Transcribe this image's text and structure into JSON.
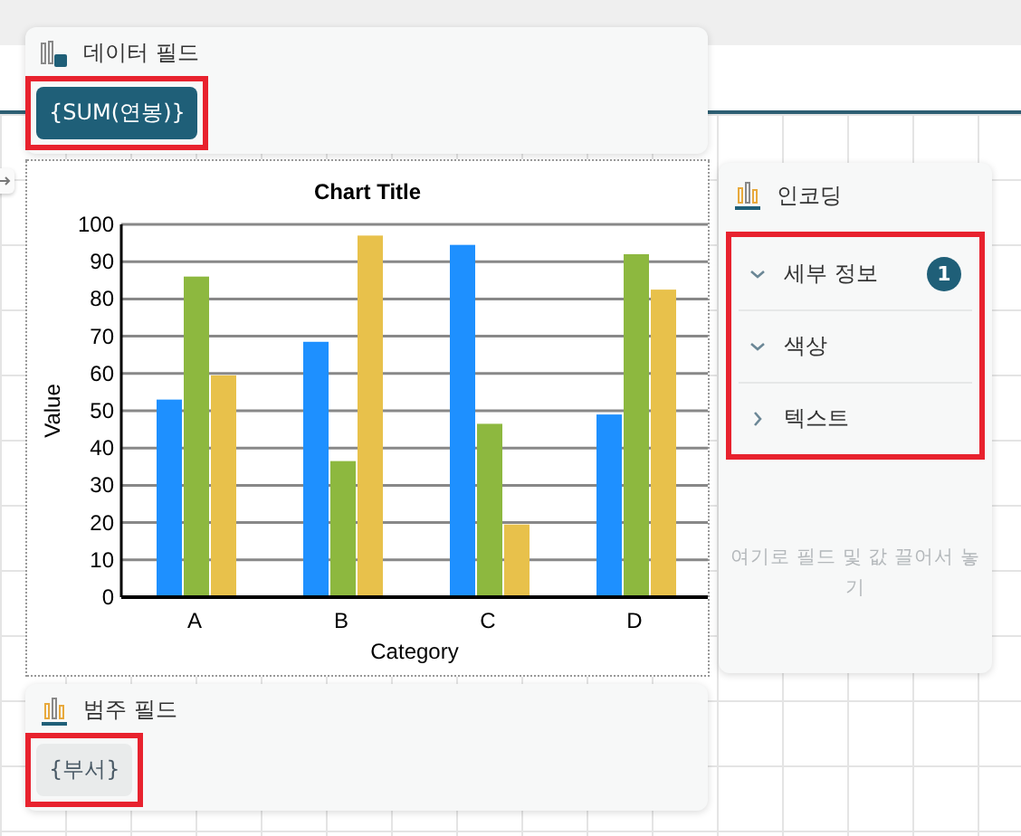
{
  "data_field": {
    "title": "데이터 필드",
    "chips": [
      {
        "label": "{SUM(연봉)}",
        "selected": true,
        "highlighted": true
      }
    ]
  },
  "chart": {
    "chart_data": {
      "type": "bar",
      "title": "Chart Title",
      "xlabel": "Category",
      "ylabel": "Value",
      "categories": [
        "A",
        "B",
        "C",
        "D"
      ],
      "ylim": [
        0,
        100
      ],
      "grid": true,
      "yticks": [
        0,
        10,
        20,
        30,
        40,
        50,
        60,
        70,
        80,
        90,
        100
      ],
      "series": [
        {
          "color": "#1e90ff",
          "values": [
            53,
            68.5,
            94.5,
            49
          ]
        },
        {
          "color": "#8db83f",
          "values": [
            86,
            36.5,
            46.5,
            92
          ]
        },
        {
          "color": "#e8c14b",
          "values": [
            59.5,
            97,
            19.5,
            82.5
          ]
        }
      ]
    }
  },
  "encoding": {
    "title": "인코딩",
    "highlighted": true,
    "sections": [
      {
        "label": "세부 정보",
        "expanded": true,
        "badge": "1"
      },
      {
        "label": "색상",
        "expanded": true
      },
      {
        "label": "텍스트",
        "expanded": false
      }
    ],
    "drop_hint": "여기로 필드 및 값 끌어서 놓기"
  },
  "category_field": {
    "title": "범주 필드",
    "chips": [
      {
        "label": "{부서}",
        "selected": false,
        "highlighted": true
      }
    ]
  }
}
